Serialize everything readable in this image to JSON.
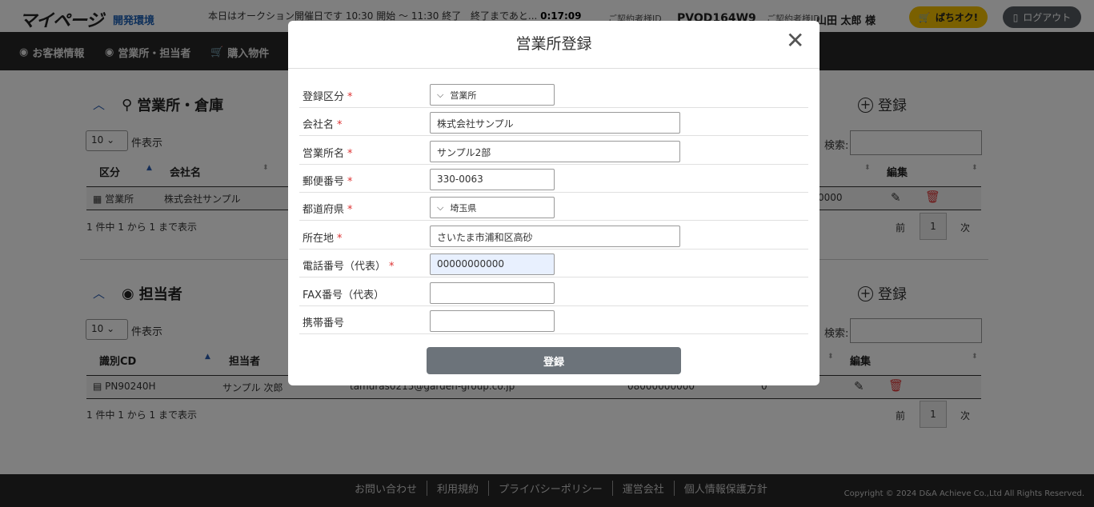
{
  "header": {
    "logo": "マイページ",
    "env": "開発環境",
    "auction_text": "本日はオークション開催日です 10:30 開始 ～ 11:30 終了",
    "remain_label": "終了まであと...",
    "remain_time": "0:17:09",
    "contract_id_label": "ご契約者様ID",
    "contract_id": "PVOD164W9",
    "contract_name_label": "ご契約者様ID",
    "contract_name": "山田 太郎 様",
    "pachi_button": "ぱちオク!",
    "logout_button": "ログアウト"
  },
  "nav": {
    "items": [
      {
        "label": "お客様情報"
      },
      {
        "label": "営業所・担当者"
      },
      {
        "label": "購入物件"
      }
    ]
  },
  "offices": {
    "title": "営業所・倉庫",
    "register": "登録",
    "per_page": "10",
    "per_page_label": "件表示",
    "search_label": "検索:",
    "columns": [
      "区分",
      "会社名",
      "編集"
    ],
    "rows": [
      {
        "kubun": "営業所",
        "company": "株式会社サンプル",
        "tail": "0000"
      }
    ],
    "summary": "1 件中 1 から 1 まで表示",
    "prev": "前",
    "page": "1",
    "next": "次"
  },
  "staff": {
    "title": "担当者",
    "register": "登録",
    "per_page": "10",
    "per_page_label": "件表示",
    "search_label": "検索:",
    "columns": [
      "識別CD",
      "担当者",
      "編集"
    ],
    "rows": [
      {
        "id": "PN90240H",
        "name": "サンプル 次郎",
        "email": "tamuras0215@garden-group.co.jp",
        "phone": "08000000000",
        "count": "0"
      }
    ],
    "summary": "1 件中 1 から 1 まで表示",
    "prev": "前",
    "page": "1",
    "next": "次"
  },
  "footer": {
    "links": [
      "お問い合わせ",
      "利用規約",
      "プライバシーポリシー",
      "運営会社",
      "個人情報保護方針"
    ],
    "copyright": "Copyright © 2024 D&A Achieve Co.,Ltd All Rights Reserved."
  },
  "modal": {
    "title": "営業所登録",
    "fields": [
      {
        "label": "登録区分",
        "required": "*",
        "value": "営業所",
        "placeholder": ""
      },
      {
        "label": "会社名",
        "required": "*",
        "value": "株式会社サンプル",
        "placeholder": ""
      },
      {
        "label": "営業所名",
        "required": "*",
        "value": "サンプル2部",
        "placeholder": ""
      },
      {
        "label": "郵便番号",
        "required": "*",
        "value": "330-0063",
        "placeholder": ""
      },
      {
        "label": "都道府県",
        "required": "*",
        "value": "埼玉県",
        "placeholder": ""
      },
      {
        "label": "所在地",
        "required": "*",
        "value": "さいたま市浦和区高砂",
        "placeholder": ""
      },
      {
        "label": "電話番号（代表）",
        "required": "*",
        "value": "00000000000",
        "placeholder": ""
      },
      {
        "label": "FAX番号（代表）",
        "required": "",
        "value": "",
        "placeholder": ""
      },
      {
        "label": "携帯番号",
        "required": "",
        "value": "",
        "placeholder": ""
      }
    ],
    "submit": "登録"
  },
  "colors": {
    "accent_yellow": "#f5c000",
    "nav_dark": "#262626",
    "required_red": "#d33333",
    "link_blue": "#1a5fb4"
  }
}
